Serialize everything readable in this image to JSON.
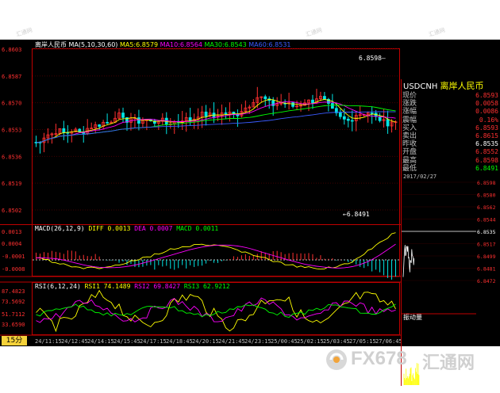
{
  "chart": {
    "name": "离岸人民币",
    "ma_label": "MA(5,10,30,60)",
    "ma": [
      {
        "label": "MA5",
        "value": "6.8579",
        "color": "#ffff00"
      },
      {
        "label": "MA10",
        "value": "6.8564",
        "color": "#ff00ff"
      },
      {
        "label": "MA30",
        "value": "6.8543",
        "color": "#00ff00"
      },
      {
        "label": "MA60",
        "value": "6.8531",
        "color": "#3a5bff"
      }
    ],
    "price_ticks": [
      "6.8603",
      "6.8587",
      "6.8570",
      "6.8553",
      "6.8536",
      "6.8519",
      "6.8502"
    ],
    "high_marker": "6.8598",
    "low_marker": "6.8491",
    "macd": {
      "params": "MACD(26,12,9)",
      "diff": "DIFF 0.0013",
      "dea": "DEA 0.0007",
      "macd": "MACD 0.0011",
      "ticks": [
        "0.0013",
        "0.0004",
        "-0.0001",
        "-0.0008"
      ]
    },
    "rsi": {
      "params": "RSI(6,12,24)",
      "rsi1": "RSI1 74.1489",
      "rsi2": "RSI2 69.8427",
      "rsi3": "RSI3 62.9212",
      "ticks": [
        "87.4823",
        "73.5692",
        "51.7112",
        "33.6590"
      ]
    },
    "time_labels": [
      "24/11:15",
      "24/12:45",
      "24/14:15",
      "24/15:45",
      "24/17:15",
      "24/18:45",
      "24/20:15",
      "24/21:45",
      "24/23:15",
      "25/00:45",
      "25/02:15",
      "25/03:45",
      "27/05:15",
      "27/06:45"
    ],
    "timeframe": "15分"
  },
  "quote": {
    "symbol": "USDCNH",
    "name": "离岸人民币",
    "rows": [
      {
        "label": "现价",
        "value": "6.8593",
        "color": "#ff3030"
      },
      {
        "label": "涨跌",
        "value": "0.0058",
        "color": "#ff3030"
      },
      {
        "label": "涨幅",
        "value": "0.0086",
        "color": "#ff3030"
      },
      {
        "label": "震幅",
        "value": "0.16%",
        "color": "#ff3030"
      },
      {
        "label": "买入",
        "value": "6.8593",
        "color": "#ff3030"
      },
      {
        "label": "卖出",
        "value": "6.8615",
        "color": "#ff3030"
      },
      {
        "label": "昨收",
        "value": "6.8535",
        "color": "#ffffff"
      },
      {
        "label": "开盘",
        "value": "6.8552",
        "color": "#ff3030"
      },
      {
        "label": "最高",
        "value": "6.8598",
        "color": "#ff3030"
      },
      {
        "label": "最低",
        "value": "6.8491",
        "color": "#00ff00"
      }
    ],
    "intraday_date": "2017/02/27",
    "intraday_ticks": [
      "6.8598",
      "6.8580",
      "6.8562",
      "6.8544",
      "6.8535",
      "6.8517",
      "6.8499",
      "6.8481",
      "6.8472"
    ],
    "volume_label": "振动量"
  },
  "watermark": {
    "text": "FX678",
    "sub": "汇通网",
    "stamp": "汇通网"
  }
}
